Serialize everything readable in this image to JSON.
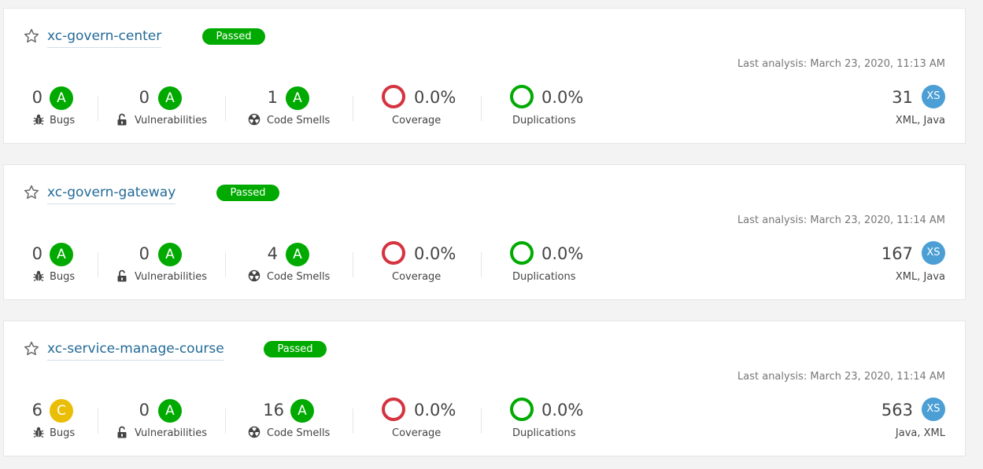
{
  "labels": {
    "bugs": "Bugs",
    "vulnerabilities": "Vulnerabilities",
    "code_smells": "Code Smells",
    "coverage": "Coverage",
    "duplications": "Duplications"
  },
  "colors": {
    "passed": "#00aa00",
    "rating_a": "#00aa00",
    "rating_c": "#eabe06",
    "coverage_ring": "#d4333f",
    "duplications_ring": "#00aa00",
    "size_badge": "#4b9fd5",
    "project_link": "#236a97"
  },
  "projects": [
    {
      "name": "xc-govern-center",
      "status": "Passed",
      "last_analysis": "Last analysis: March 23, 2020, 11:13 AM",
      "bugs": "0",
      "bugs_rating": "A",
      "vulnerabilities": "0",
      "vulnerabilities_rating": "A",
      "code_smells": "1",
      "code_smells_rating": "A",
      "coverage": "0.0%",
      "duplications": "0.0%",
      "lines": "31",
      "size": "XS",
      "languages": "XML, Java"
    },
    {
      "name": "xc-govern-gateway",
      "status": "Passed",
      "last_analysis": "Last analysis: March 23, 2020, 11:14 AM",
      "bugs": "0",
      "bugs_rating": "A",
      "vulnerabilities": "0",
      "vulnerabilities_rating": "A",
      "code_smells": "4",
      "code_smells_rating": "A",
      "coverage": "0.0%",
      "duplications": "0.0%",
      "lines": "167",
      "size": "XS",
      "languages": "XML, Java"
    },
    {
      "name": "xc-service-manage-course",
      "status": "Passed",
      "last_analysis": "Last analysis: March 23, 2020, 11:14 AM",
      "bugs": "6",
      "bugs_rating": "C",
      "vulnerabilities": "0",
      "vulnerabilities_rating": "A",
      "code_smells": "16",
      "code_smells_rating": "A",
      "coverage": "0.0%",
      "duplications": "0.0%",
      "lines": "563",
      "size": "XS",
      "languages": "Java, XML"
    }
  ]
}
